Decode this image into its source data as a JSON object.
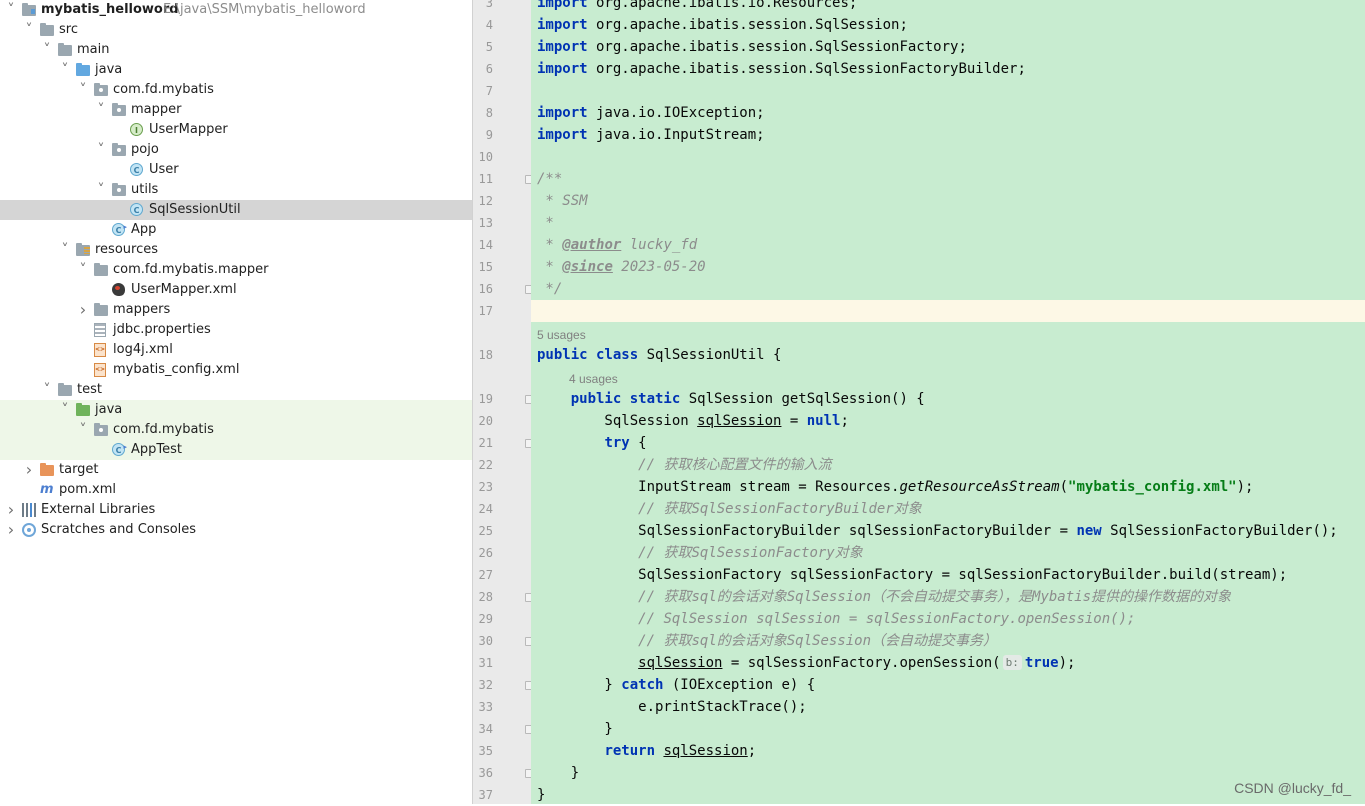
{
  "project_tree": {
    "rows": [
      {
        "label": "mybatis_helloword",
        "path": "E:\\java\\SSM\\mybatis_helloword",
        "indent": 0,
        "chevron": "down",
        "icon": "module",
        "bold": true
      },
      {
        "label": "src",
        "indent": 1,
        "chevron": "down",
        "icon": "folder"
      },
      {
        "label": "main",
        "indent": 2,
        "chevron": "down",
        "icon": "folder"
      },
      {
        "label": "java",
        "indent": 3,
        "chevron": "down",
        "icon": "source-folder"
      },
      {
        "label": "com.fd.mybatis",
        "indent": 4,
        "chevron": "down",
        "icon": "package"
      },
      {
        "label": "mapper",
        "indent": 5,
        "chevron": "down",
        "icon": "package"
      },
      {
        "label": "UserMapper",
        "indent": 6,
        "chevron": "none",
        "icon": "interface"
      },
      {
        "label": "pojo",
        "indent": 5,
        "chevron": "down",
        "icon": "package"
      },
      {
        "label": "User",
        "indent": 6,
        "chevron": "none",
        "icon": "class"
      },
      {
        "label": "utils",
        "indent": 5,
        "chevron": "down",
        "icon": "package"
      },
      {
        "label": "SqlSessionUtil",
        "indent": 6,
        "chevron": "none",
        "icon": "class",
        "selected": true
      },
      {
        "label": "App",
        "indent": 5,
        "chevron": "none",
        "icon": "main-class"
      },
      {
        "label": "resources",
        "indent": 3,
        "chevron": "down",
        "icon": "resources-folder"
      },
      {
        "label": "com.fd.mybatis.mapper",
        "indent": 4,
        "chevron": "down",
        "icon": "folder"
      },
      {
        "label": "UserMapper.xml",
        "indent": 5,
        "chevron": "none",
        "icon": "mybatis-xml"
      },
      {
        "label": "mappers",
        "indent": 4,
        "chevron": "right",
        "icon": "folder"
      },
      {
        "label": "jdbc.properties",
        "indent": 4,
        "chevron": "none",
        "icon": "properties-file"
      },
      {
        "label": "log4j.xml",
        "indent": 4,
        "chevron": "none",
        "icon": "xml-file"
      },
      {
        "label": "mybatis_config.xml",
        "indent": 4,
        "chevron": "none",
        "icon": "xml-file"
      },
      {
        "label": "test",
        "indent": 2,
        "chevron": "down",
        "icon": "folder"
      },
      {
        "label": "java",
        "indent": 3,
        "chevron": "down",
        "icon": "test-source-folder",
        "test": true
      },
      {
        "label": "com.fd.mybatis",
        "indent": 4,
        "chevron": "down",
        "icon": "package",
        "test": true
      },
      {
        "label": "AppTest",
        "indent": 5,
        "chevron": "none",
        "icon": "main-class",
        "test": true
      },
      {
        "label": "target",
        "indent": 1,
        "chevron": "right",
        "icon": "excluded-folder"
      },
      {
        "label": "pom.xml",
        "indent": 1,
        "chevron": "none",
        "icon": "maven-icon"
      },
      {
        "label": "External Libraries",
        "indent": 0,
        "chevron": "right",
        "icon": "libraries"
      },
      {
        "label": "Scratches and Consoles",
        "indent": 0,
        "chevron": "right",
        "icon": "scratches"
      }
    ]
  },
  "editor": {
    "colors": {
      "code_bg": "#c8ecd0",
      "gutter_bg": "#eaeaea",
      "current_line": "#fdf8e6",
      "keyword": "#0033b3",
      "string": "#067d17",
      "comment": "#8c8c8c"
    },
    "usages_class": "5 usages",
    "usages_method": "4 usages",
    "current_line": 17,
    "lines": [
      {
        "n": 3,
        "html": "<span class=\"k\">import</span> org.apache.ibatis.io.Resources;"
      },
      {
        "n": 4,
        "html": "<span class=\"k\">import</span> org.apache.ibatis.session.SqlSession;"
      },
      {
        "n": 5,
        "html": "<span class=\"k\">import</span> org.apache.ibatis.session.SqlSessionFactory;"
      },
      {
        "n": 6,
        "html": "<span class=\"k\">import</span> org.apache.ibatis.session.SqlSessionFactoryBuilder;"
      },
      {
        "n": 7,
        "html": ""
      },
      {
        "n": 8,
        "html": "<span class=\"k\">import</span> java.io.IOException;"
      },
      {
        "n": 9,
        "html": "<span class=\"k\">import</span> java.io.InputStream;"
      },
      {
        "n": 10,
        "html": ""
      },
      {
        "n": 11,
        "html": "<span class=\"c\">/**</span>"
      },
      {
        "n": 12,
        "html": "<span class=\"c\"> * SSM</span>"
      },
      {
        "n": 13,
        "html": "<span class=\"c\"> *</span>"
      },
      {
        "n": 14,
        "html": "<span class=\"c\"> * </span><span class=\"dt\">@author</span><span class=\"c\"> lucky_fd</span>"
      },
      {
        "n": 15,
        "html": "<span class=\"c\"> * </span><span class=\"dt\">@since</span><span class=\"c\"> 2023-05-20</span>"
      },
      {
        "n": 16,
        "html": "<span class=\"c\"> */</span>"
      },
      {
        "n": 17,
        "html": ""
      },
      {
        "n": 18,
        "html": "<span class=\"k\">public class</span> SqlSessionUtil {"
      },
      {
        "n": 19,
        "html": "    <span class=\"k\">public static</span> SqlSession getSqlSession() {"
      },
      {
        "n": 20,
        "html": "        SqlSession <span class=\"u\">sqlSession</span> = <span class=\"k\">null</span>;"
      },
      {
        "n": 21,
        "html": "        <span class=\"k\">try</span> {"
      },
      {
        "n": 22,
        "html": "            <span class=\"c\">// 获取核心配置文件的输入流</span>"
      },
      {
        "n": 23,
        "html": "            InputStream stream = Resources.<span class=\"it\">getResourceAsStream</span>(<span class=\"s\">\"mybatis_config.xml\"</span>);"
      },
      {
        "n": 24,
        "html": "            <span class=\"c\">// 获取SqlSessionFactoryBuilder对象</span>"
      },
      {
        "n": 25,
        "html": "            SqlSessionFactoryBuilder sqlSessionFactoryBuilder = <span class=\"k\">new</span> SqlSessionFactoryBuilder();"
      },
      {
        "n": 26,
        "html": "            <span class=\"c\">// 获取SqlSessionFactory对象</span>"
      },
      {
        "n": 27,
        "html": "            SqlSessionFactory sqlSessionFactory = sqlSessionFactoryBuilder.build(stream);"
      },
      {
        "n": 28,
        "html": "            <span class=\"c\">// 获取sql的会话对象SqlSession（不会自动提交事务），是Mybatis提供的操作数据的对象</span>"
      },
      {
        "n": 29,
        "html": "            <span class=\"c\">// SqlSession sqlSession = sqlSessionFactory.openSession();</span>"
      },
      {
        "n": 30,
        "html": "            <span class=\"c\">// 获取sql的会话对象SqlSession（会自动提交事务）</span>"
      },
      {
        "n": 31,
        "html": "            <span class=\"u\">sqlSession</span> = sqlSessionFactory.openSession(<span class=\"hint\">b:</span><span class=\"k\">true</span>);"
      },
      {
        "n": 32,
        "html": "        } <span class=\"k\">catch</span> (IOException e) {"
      },
      {
        "n": 33,
        "html": "            e.printStackTrace();"
      },
      {
        "n": 34,
        "html": "        }"
      },
      {
        "n": 35,
        "html": "        <span class=\"k\">return</span> <span class=\"u\">sqlSession</span>;"
      },
      {
        "n": 36,
        "html": "    }"
      },
      {
        "n": 37,
        "html": "}"
      }
    ],
    "fold_markers": [
      11,
      16,
      19,
      21,
      28,
      30,
      32,
      34,
      36
    ]
  },
  "watermark": "CSDN @lucky_fd_"
}
